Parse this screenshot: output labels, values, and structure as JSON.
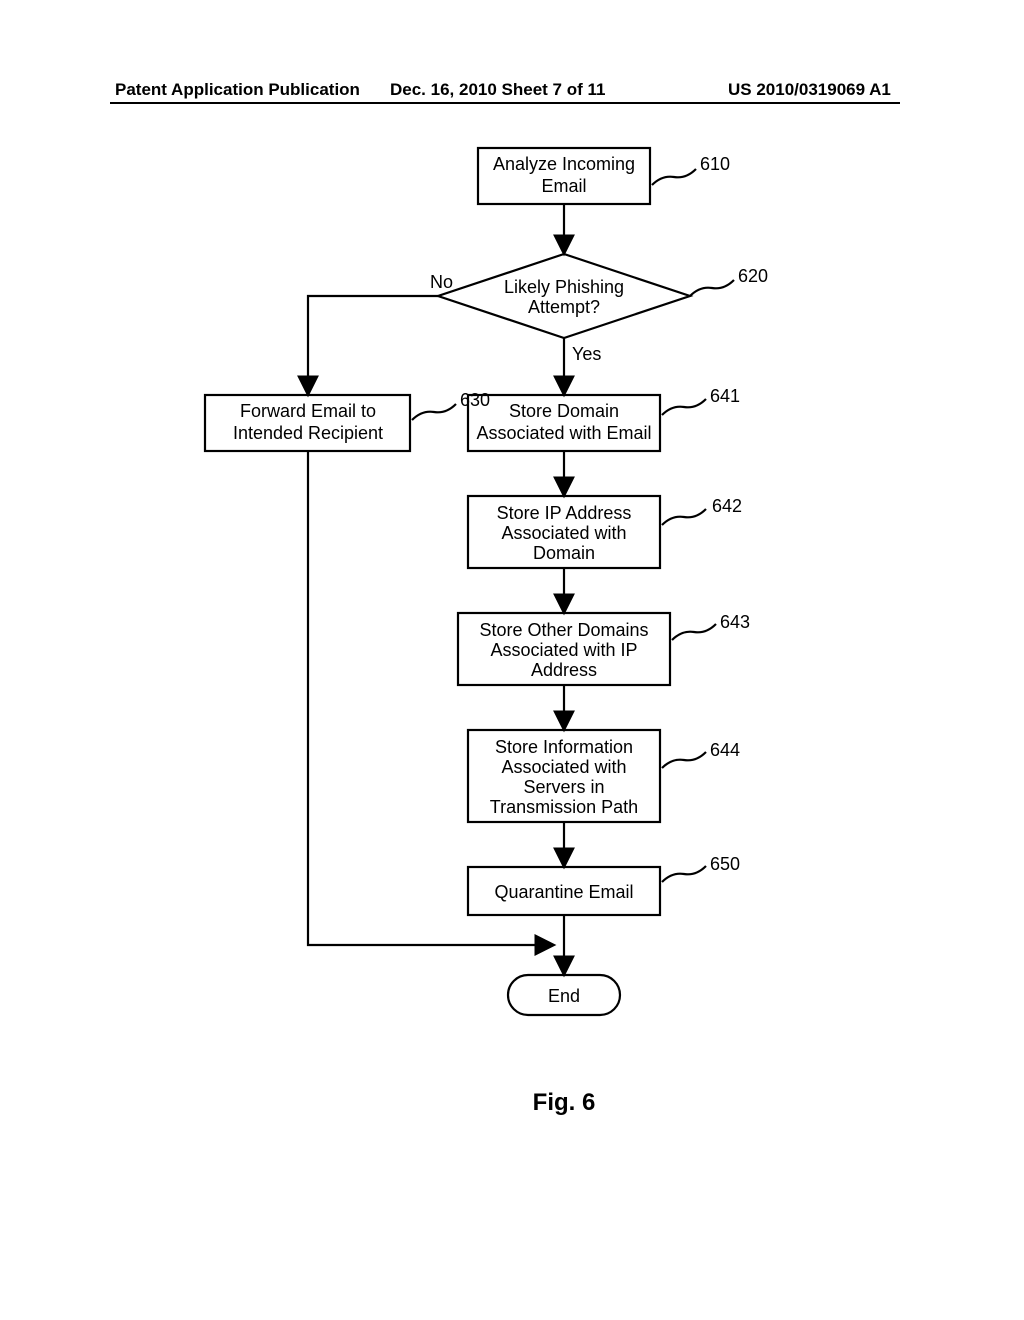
{
  "header": {
    "left": "Patent Application Publication",
    "mid": "Dec. 16, 2010   Sheet 7 of 11",
    "right": "US 2010/0319069 A1"
  },
  "nodes": {
    "n610": "Analyze Incoming Email",
    "n620": "Likely Phishing Attempt?",
    "n630": "Forward Email to Intended Recipient",
    "n641": "Store Domain Associated with Email",
    "n642": "Store IP Address Associated with Domain",
    "n643": "Store Other Domains Associated with IP Address",
    "n644": "Store Information Associated with Servers in Transmission Path",
    "n650": "Quarantine Email",
    "end": "End"
  },
  "refs": {
    "r610": "610",
    "r620": "620",
    "r630": "630",
    "r641": "641",
    "r642": "642",
    "r643": "643",
    "r644": "644",
    "r650": "650"
  },
  "edges": {
    "no": "No",
    "yes": "Yes"
  },
  "figure": "Fig. 6"
}
